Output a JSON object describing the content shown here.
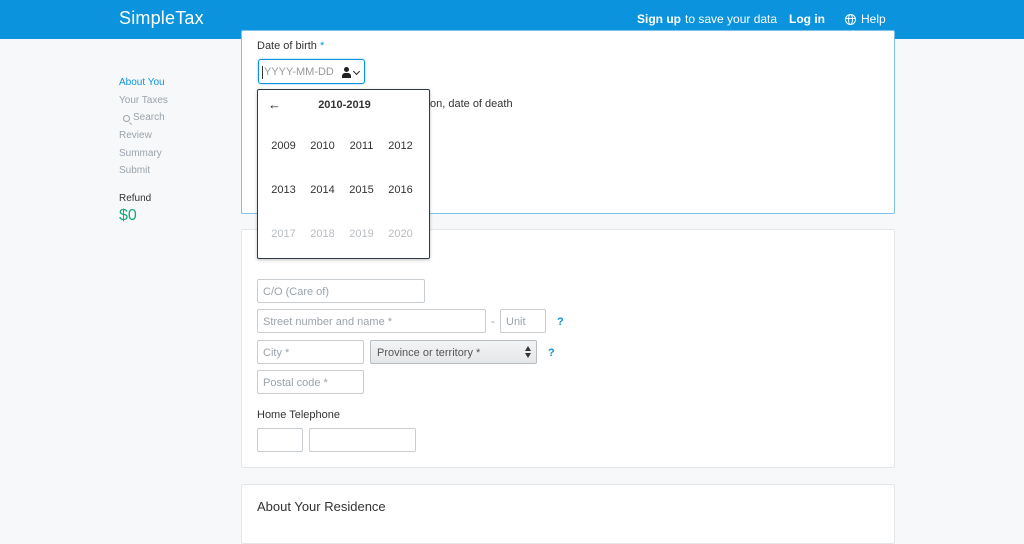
{
  "header": {
    "brand": "SimpleTax",
    "signup_bold": "Sign up",
    "signup_rest": "to save your data",
    "login": "Log in",
    "help": "Help"
  },
  "sidebar": {
    "items": [
      {
        "label": "About You",
        "active": true
      },
      {
        "label": "Your Taxes",
        "active": false
      },
      {
        "label": "Search",
        "active": false
      },
      {
        "label": "Review",
        "active": false
      },
      {
        "label": "Summary",
        "active": false
      },
      {
        "label": "Submit",
        "active": false
      }
    ],
    "refund_label": "Refund",
    "refund_amount": "$0"
  },
  "personal": {
    "dob_label": "Date of birth",
    "required_mark": "*",
    "dob_placeholder": "YYYY-MM-DD",
    "partial_text": "on, date of death"
  },
  "datepicker": {
    "range": "2010-2019",
    "years": [
      {
        "label": "2009",
        "dim": false
      },
      {
        "label": "2010",
        "dim": false
      },
      {
        "label": "2011",
        "dim": false
      },
      {
        "label": "2012",
        "dim": false
      },
      {
        "label": "2013",
        "dim": false
      },
      {
        "label": "2014",
        "dim": false
      },
      {
        "label": "2015",
        "dim": false
      },
      {
        "label": "2016",
        "dim": false
      },
      {
        "label": "2017",
        "dim": true
      },
      {
        "label": "2018",
        "dim": true
      },
      {
        "label": "2019",
        "dim": true
      },
      {
        "label": "2020",
        "dim": true
      }
    ]
  },
  "address": {
    "care_of_placeholder": "C/O (Care of)",
    "street_placeholder": "Street number and name *",
    "dash": "-",
    "unit_placeholder": "Unit",
    "city_placeholder": "City *",
    "province_placeholder": "Province or territory *",
    "postal_placeholder": "Postal code *",
    "help_mark": "?",
    "home_phone_label": "Home Telephone"
  },
  "residence": {
    "title": "About Your Residence"
  },
  "colors": {
    "accent": "#0b93dd",
    "refund": "#1aa87a"
  }
}
